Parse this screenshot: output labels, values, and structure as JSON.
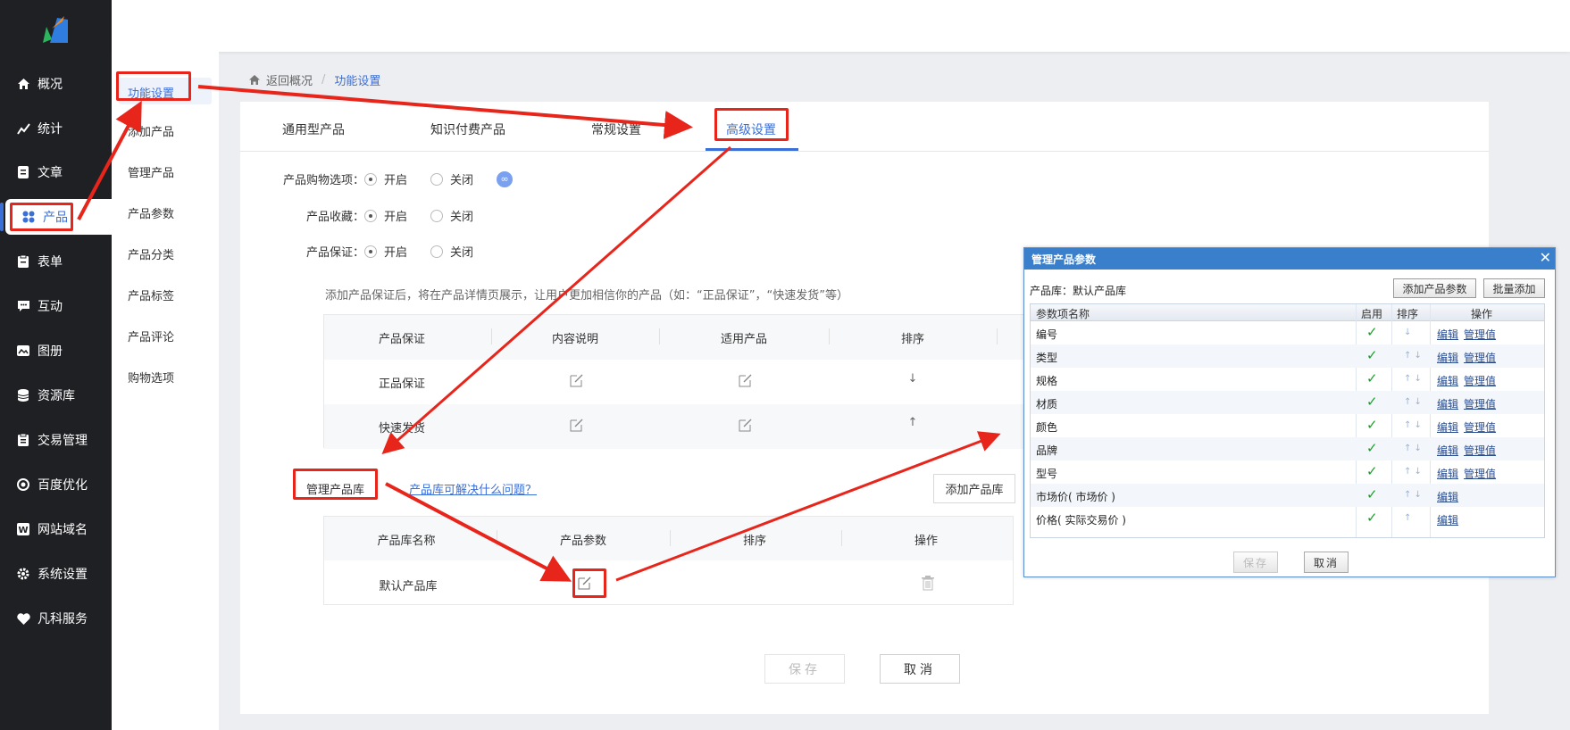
{
  "colors": {
    "accent": "#3b6fd8",
    "sidebar_bg": "#1f2024",
    "highlight_red": "#e8251b",
    "dialog_title_bg": "#3a7fcb",
    "check_green": "#1a9e2a"
  },
  "sidebar": {
    "logo_icon": "brand-logo-icon",
    "items": [
      {
        "label": "概况",
        "icon": "home-icon"
      },
      {
        "label": "统计",
        "icon": "chart-icon"
      },
      {
        "label": "文章",
        "icon": "document-icon"
      },
      {
        "label": "产品",
        "icon": "grid-icon",
        "active": true
      },
      {
        "label": "表单",
        "icon": "form-icon"
      },
      {
        "label": "互动",
        "icon": "chat-icon"
      },
      {
        "label": "图册",
        "icon": "gallery-icon"
      },
      {
        "label": "资源库",
        "icon": "database-icon"
      },
      {
        "label": "交易管理",
        "icon": "clipboard-icon"
      },
      {
        "label": "百度优化",
        "icon": "target-icon"
      },
      {
        "label": "网站域名",
        "icon": "w-icon"
      },
      {
        "label": "系统设置",
        "icon": "gear-icon"
      },
      {
        "label": "凡科服务",
        "icon": "heart-icon"
      }
    ]
  },
  "submenu": {
    "items": [
      "功能设置",
      "添加产品",
      "管理产品",
      "产品参数",
      "产品分类",
      "产品标签",
      "产品评论",
      "购物选项"
    ]
  },
  "breadcrumb": {
    "back": "返回概况",
    "separator": "/",
    "current": "功能设置"
  },
  "tabs": [
    "通用型产品",
    "知识付费产品",
    "常规设置",
    "高级设置"
  ],
  "options": [
    {
      "label": "产品购物选项：",
      "on": "开启",
      "off": "关闭",
      "selected": "on",
      "has_link": true
    },
    {
      "label": "产品收藏：",
      "on": "开启",
      "off": "关闭",
      "selected": "on"
    },
    {
      "label": "产品保证：",
      "on": "开启",
      "off": "关闭",
      "selected": "on"
    }
  ],
  "hint": "添加产品保证后，将在产品详情页展示，让用户更加相信你的产品（如：“正品保证”，“快速发货”等）",
  "guarantee_table": {
    "headers": [
      "产品保证",
      "内容说明",
      "适用产品",
      "排序"
    ],
    "rows": [
      {
        "name": "正品保证",
        "sort": "↓"
      },
      {
        "name": "快速发货",
        "sort": "↑"
      }
    ]
  },
  "library": {
    "label": "管理产品库",
    "help": "产品库可解决什么问题？",
    "add_button": "添加产品库",
    "headers": [
      "产品库名称",
      "产品参数",
      "排序",
      "操作"
    ],
    "rows": [
      {
        "name": "默认产品库"
      }
    ]
  },
  "footer": {
    "save": "保存",
    "cancel": "取消"
  },
  "dialog": {
    "title": "管理产品参数",
    "close": "✕",
    "lib_label": "产品库：默认产品库",
    "add_param": "添加产品参数",
    "batch_add": "批量添加",
    "headers": [
      "参数项名称",
      "启用",
      "排序",
      "操作"
    ],
    "edit": "编辑",
    "manage": "管理值",
    "rows": [
      {
        "name": "编号",
        "arrows": "↓",
        "manage": true
      },
      {
        "name": "类型",
        "arrows": "↑ ↓",
        "manage": true
      },
      {
        "name": "规格",
        "arrows": "↑ ↓",
        "manage": true
      },
      {
        "name": "材质",
        "arrows": "↑ ↓",
        "manage": true
      },
      {
        "name": "颜色",
        "arrows": "↑ ↓",
        "manage": true
      },
      {
        "name": "品牌",
        "arrows": "↑ ↓",
        "manage": true
      },
      {
        "name": "型号",
        "arrows": "↑ ↓",
        "manage": true
      },
      {
        "name": "市场价( 市场价 )",
        "arrows": "↑ ↓",
        "manage": false
      },
      {
        "name": "价格( 实际交易价 )",
        "arrows": "↑",
        "manage": false
      }
    ],
    "save": "保存",
    "cancel": "取消"
  }
}
